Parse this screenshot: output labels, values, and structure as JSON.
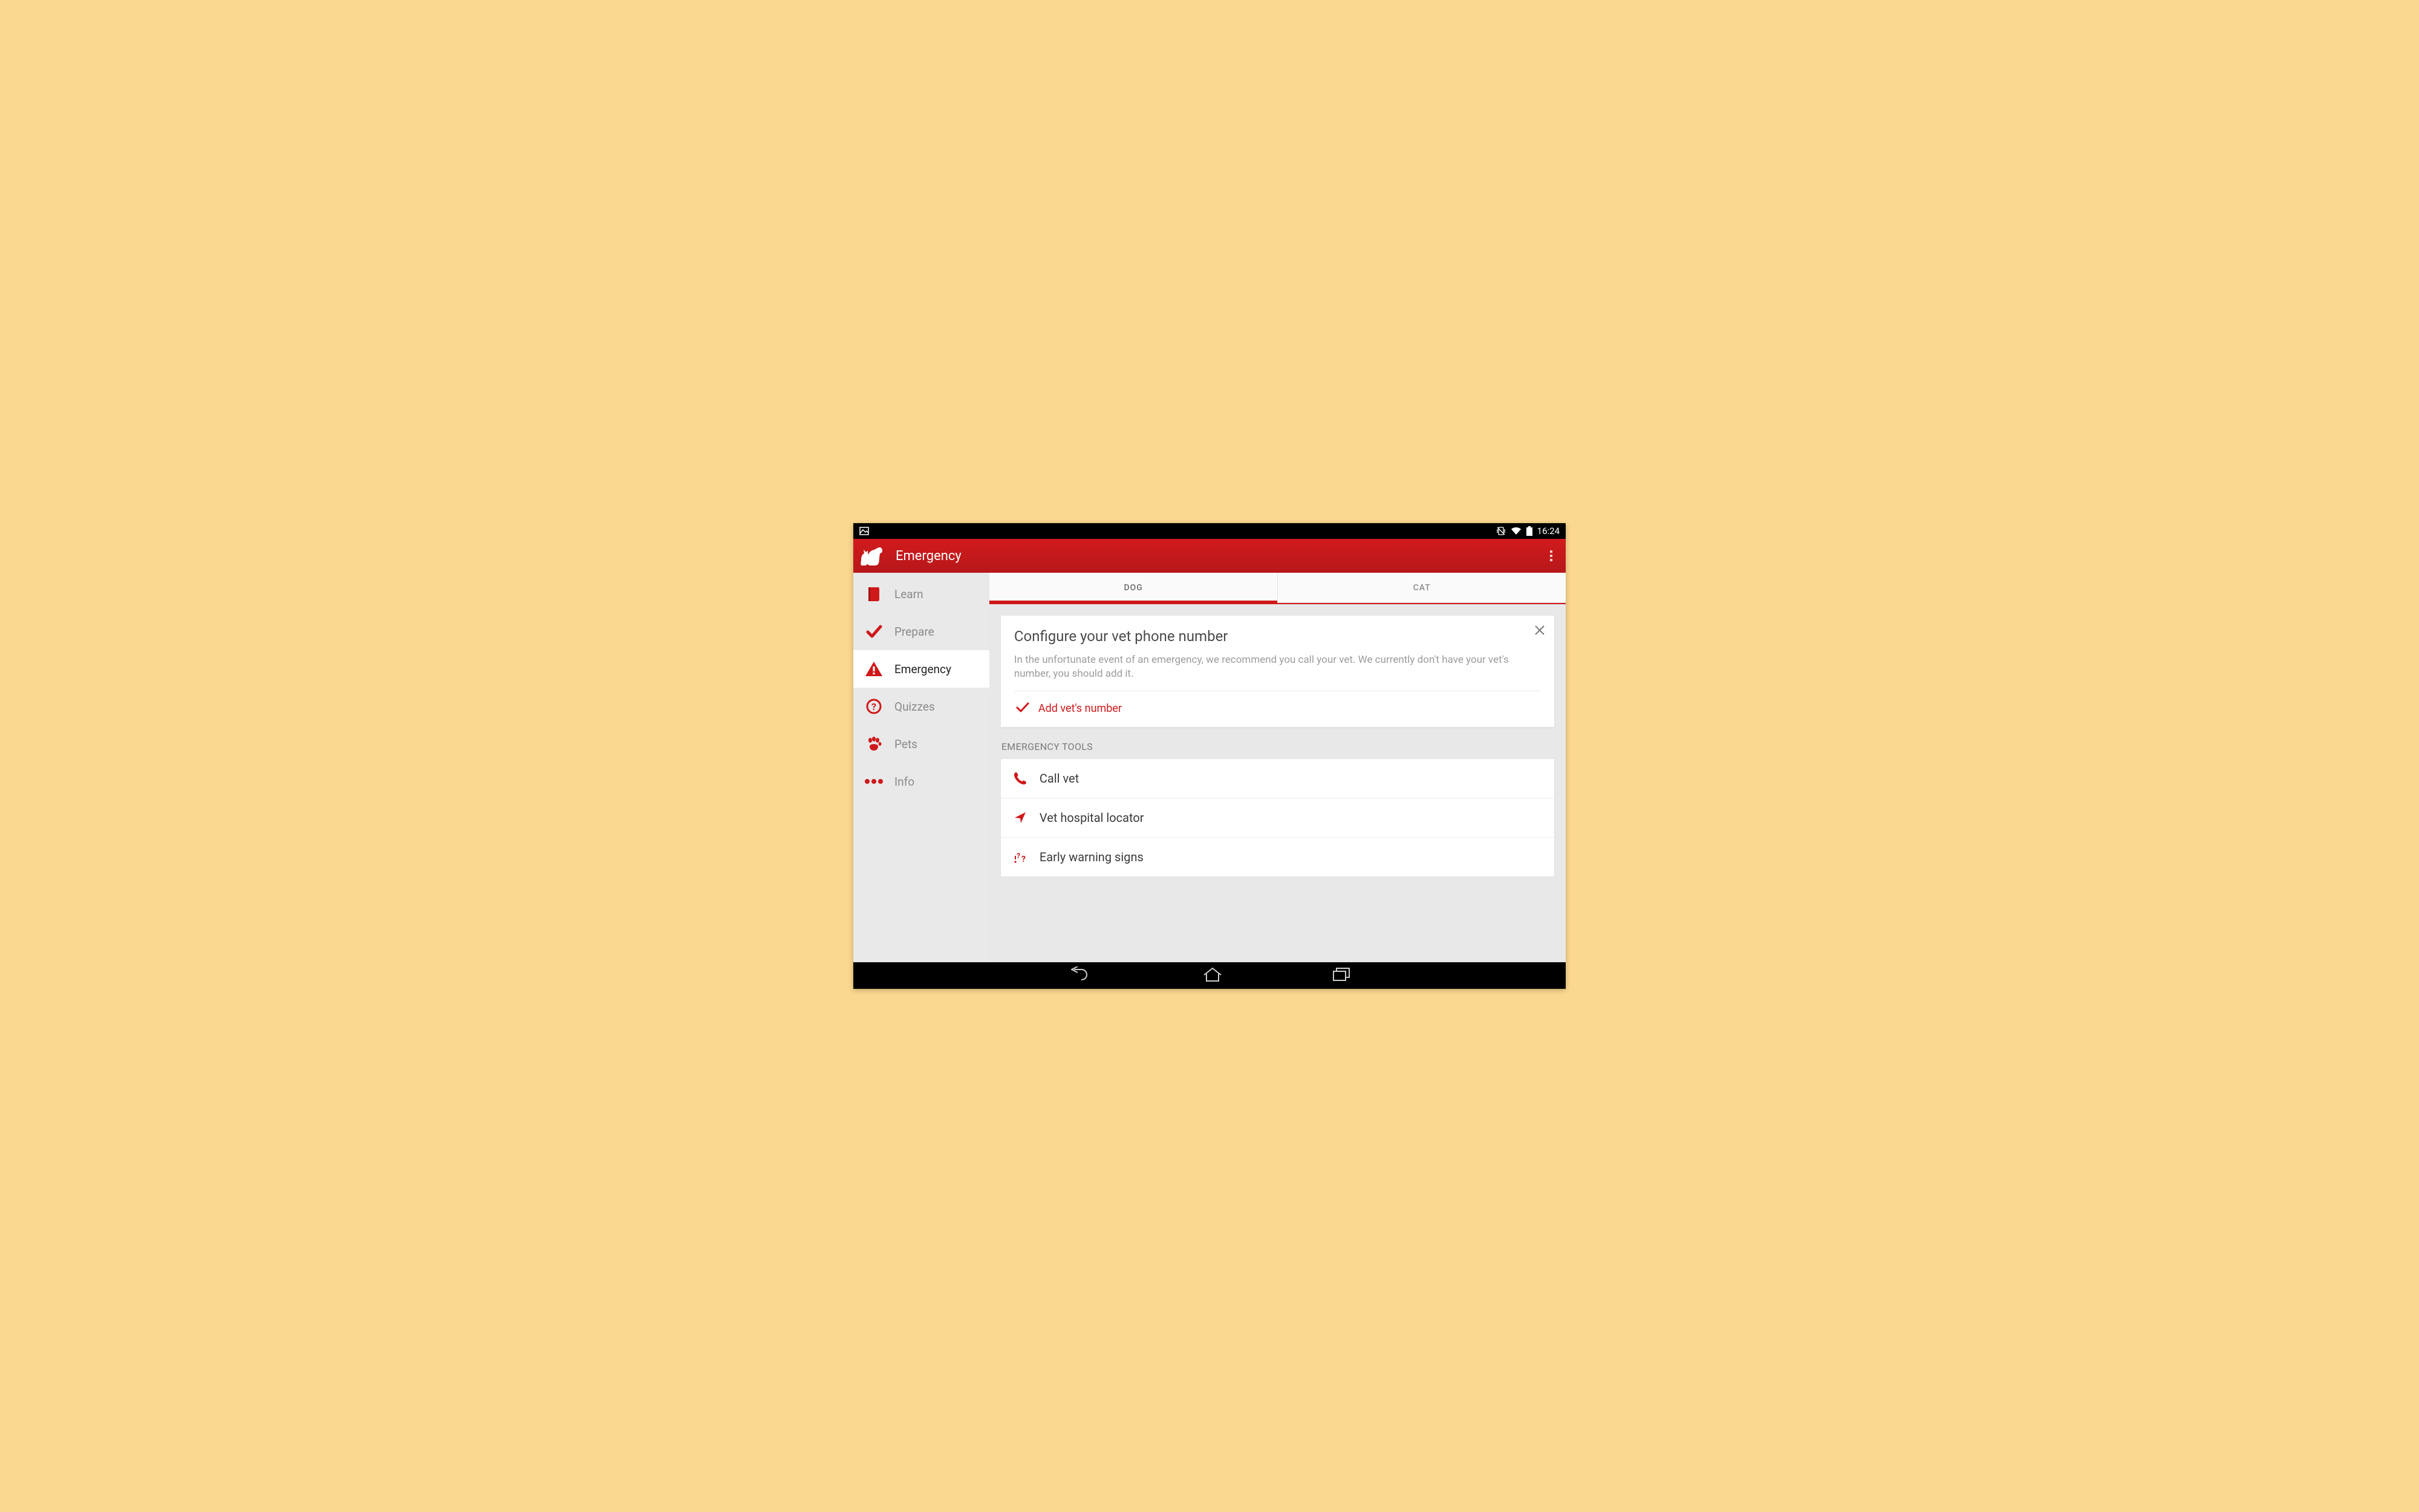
{
  "colors": {
    "brand_red": "#cf181a",
    "page_bg": "#fbd88f",
    "sidebar_bg": "#e9e9e9",
    "content_bg": "#e8e8e8"
  },
  "statusbar": {
    "time": "16:24"
  },
  "actionbar": {
    "title": "Emergency"
  },
  "sidebar": {
    "items": [
      {
        "key": "learn",
        "label": "Learn",
        "active": false
      },
      {
        "key": "prepare",
        "label": "Prepare",
        "active": false
      },
      {
        "key": "emergency",
        "label": "Emergency",
        "active": true
      },
      {
        "key": "quizzes",
        "label": "Quizzes",
        "active": false
      },
      {
        "key": "pets",
        "label": "Pets",
        "active": false
      },
      {
        "key": "info",
        "label": "Info",
        "active": false
      }
    ]
  },
  "tabs": [
    {
      "key": "dog",
      "label": "DOG",
      "active": true
    },
    {
      "key": "cat",
      "label": "CAT",
      "active": false
    }
  ],
  "configure_card": {
    "title": "Configure your vet phone number",
    "body": "In the unfortunate event of an emergency, we recommend you call your vet. We currently don't have your vet's number, you should add it.",
    "action_label": "Add vet's number"
  },
  "tools_section": {
    "header": "Emergency Tools",
    "items": [
      {
        "key": "call_vet",
        "label": "Call vet"
      },
      {
        "key": "locator",
        "label": "Vet hospital locator"
      },
      {
        "key": "warning",
        "label": "Early warning signs"
      }
    ]
  }
}
